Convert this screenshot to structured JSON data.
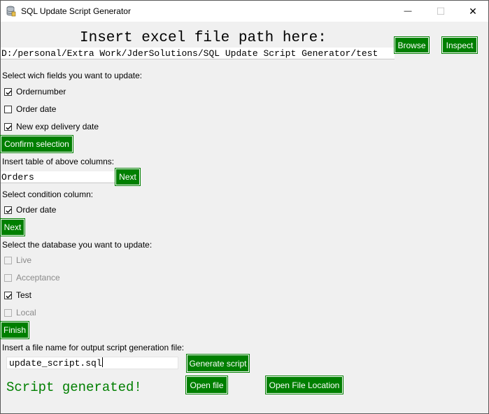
{
  "window": {
    "title": "SQL Update Script Generator",
    "minimize_glyph": "—",
    "maximize_glyph": "☐",
    "close_glyph": "✕"
  },
  "file_section": {
    "heading": "Insert excel file path here:",
    "path_value": "D:/personal/Extra Work/JderSolutions/SQL Update Script Generator/test",
    "browse_label": "Browse",
    "inspect_label": "Inspect"
  },
  "fields_section": {
    "label": "Select wich fields you want to update:",
    "options": [
      {
        "label": "Ordernumber",
        "checked": true
      },
      {
        "label": "Order date",
        "checked": false
      },
      {
        "label": "New exp delivery date",
        "checked": true
      }
    ],
    "confirm_label": "Confirm selection"
  },
  "table_section": {
    "label": "Insert table of above columns:",
    "table_value": "Orders",
    "next_label": "Next"
  },
  "condition_section": {
    "label": "Select condition column:",
    "options": [
      {
        "label": "Order date",
        "checked": true
      }
    ],
    "next_label": "Next"
  },
  "database_section": {
    "label": "Select the database you want to update:",
    "options": [
      {
        "label": "Live",
        "checked": false,
        "disabled": true
      },
      {
        "label": "Acceptance",
        "checked": false,
        "disabled": true
      },
      {
        "label": "Test",
        "checked": true,
        "disabled": false
      },
      {
        "label": "Local",
        "checked": false,
        "disabled": true
      }
    ],
    "finish_label": "Finish"
  },
  "output_section": {
    "label": "Insert a file name for output script generation file:",
    "filename_value": "update_script.sql",
    "generate_label": "Generate script",
    "status_text": "Script generated!",
    "status_color": "#007f00",
    "open_file_label": "Open file",
    "open_location_label": "Open File Location"
  },
  "colors": {
    "button_bg": "#007f00",
    "button_text": "#ffffff",
    "window_bg": "#f0f0f0"
  }
}
